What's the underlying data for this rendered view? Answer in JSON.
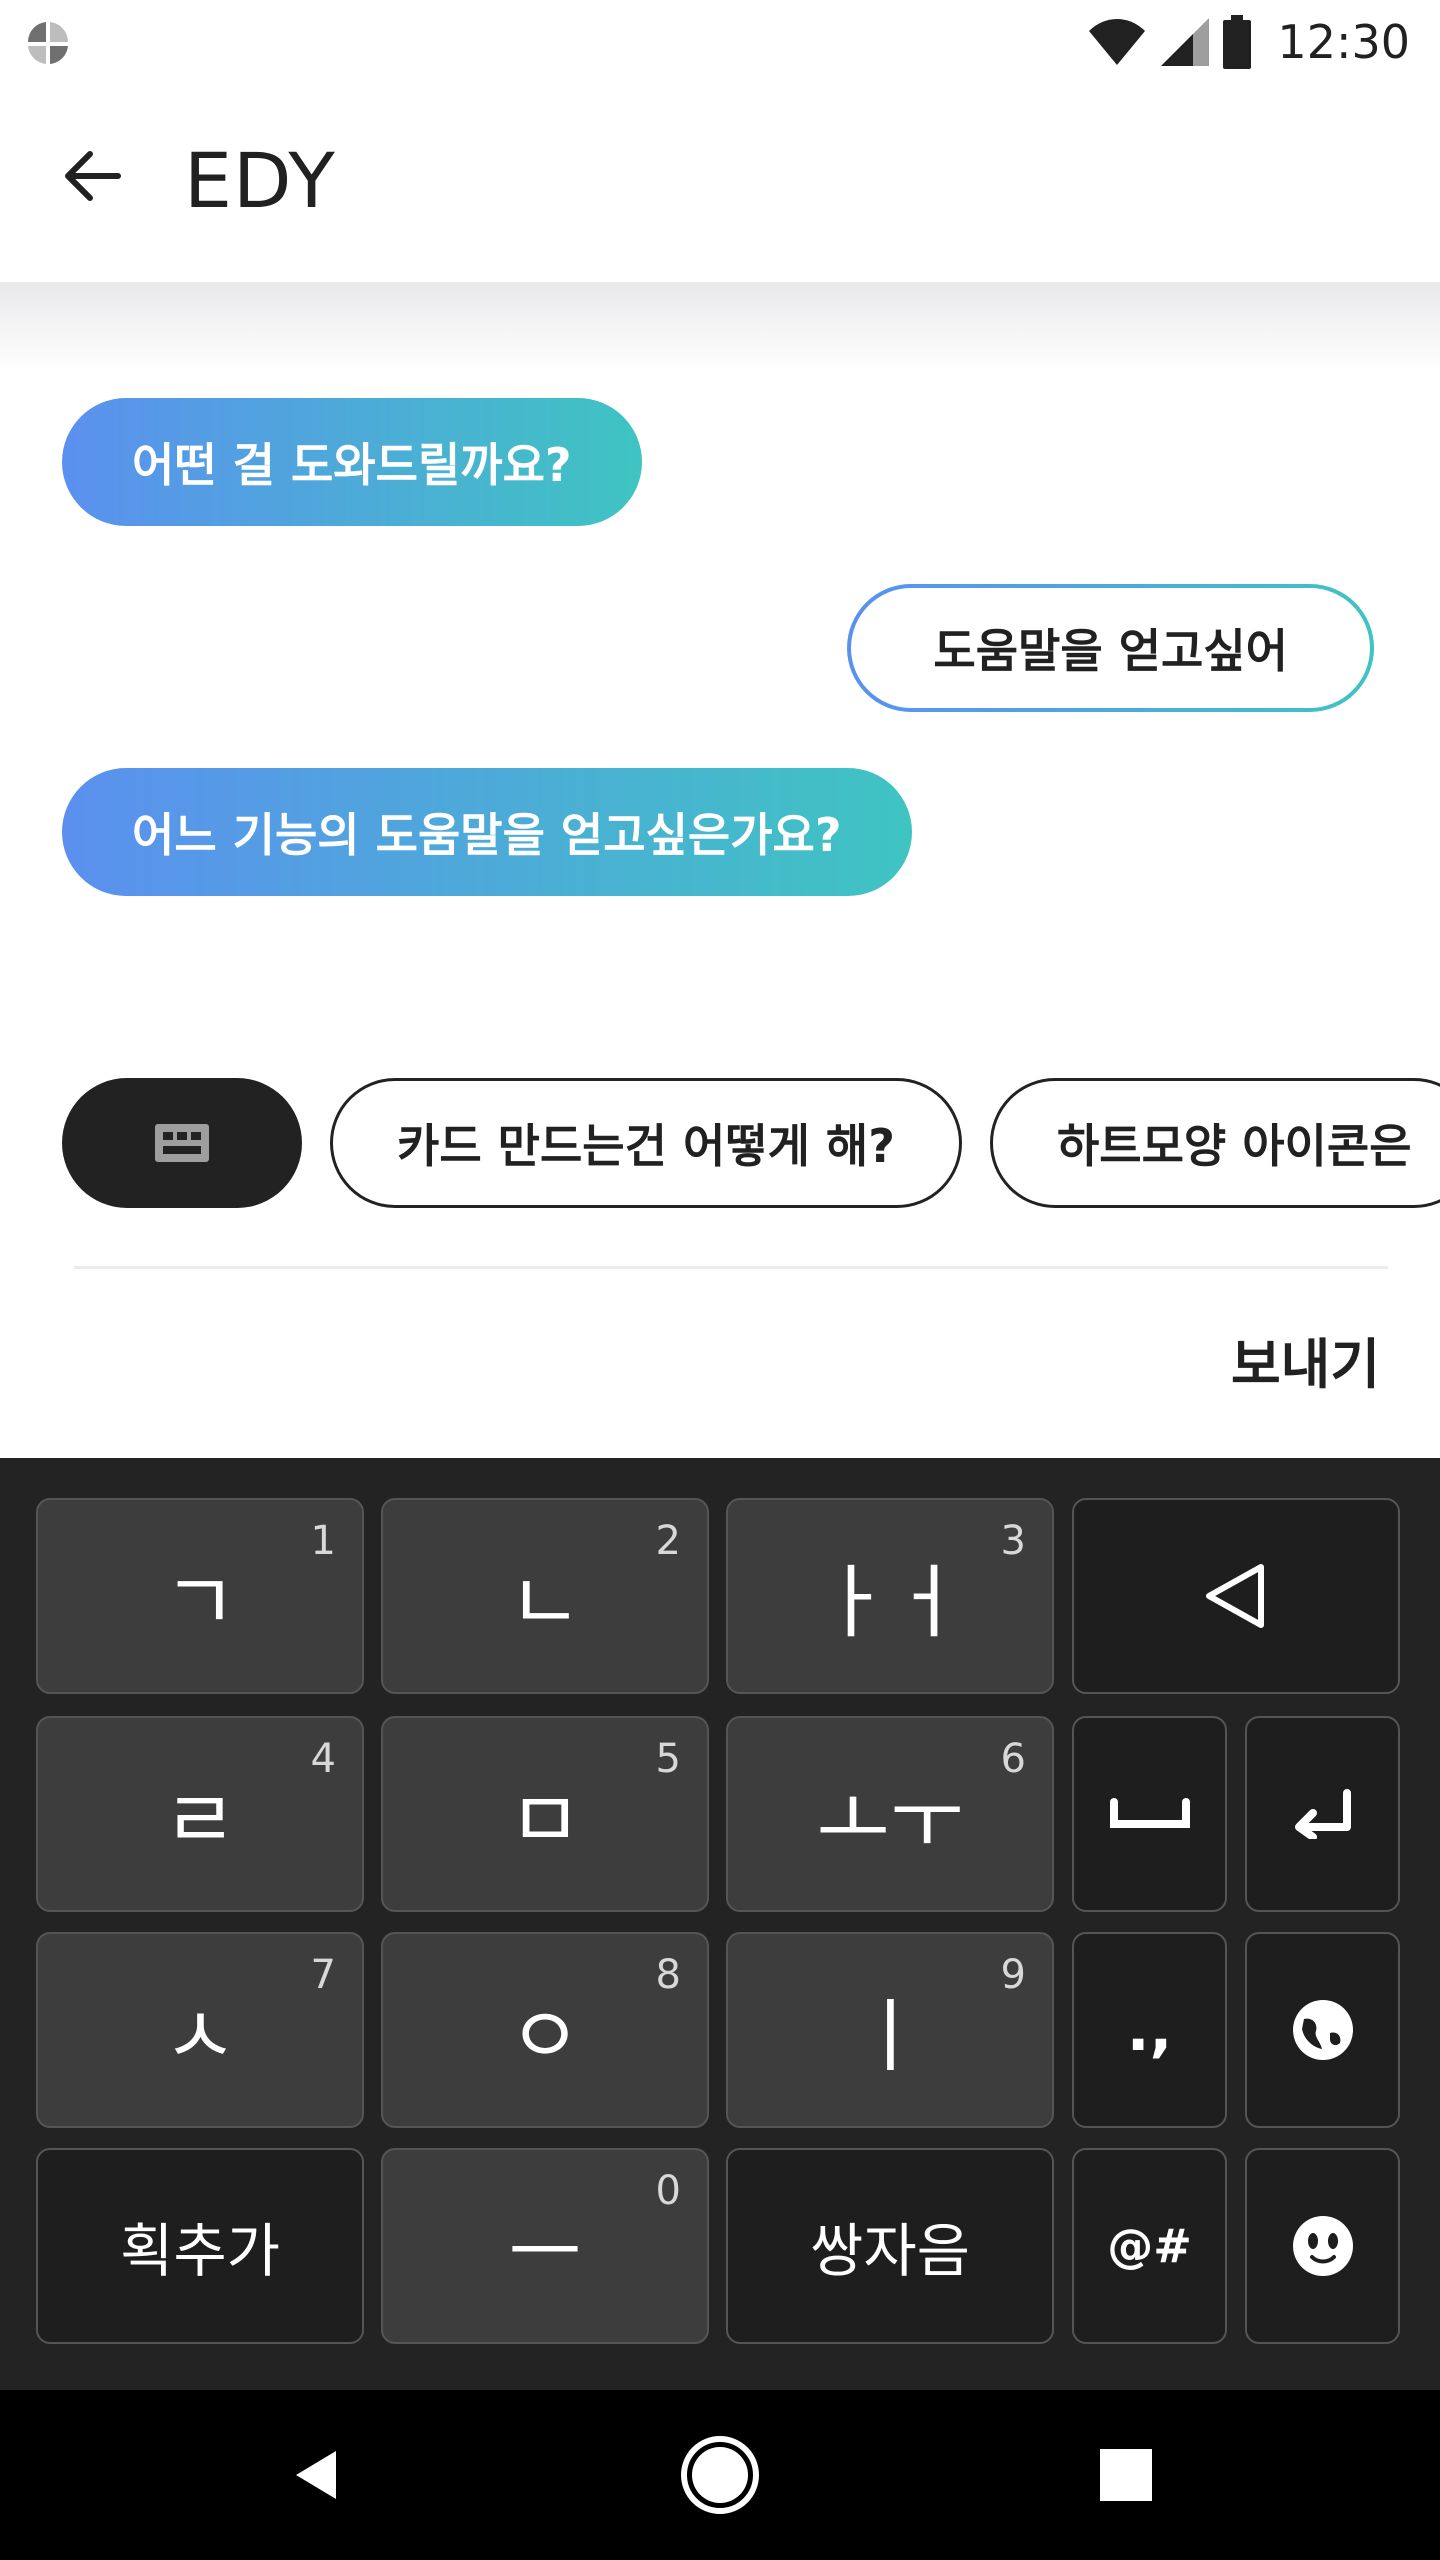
{
  "status": {
    "time": "12:30"
  },
  "app_bar": {
    "title": "EDY"
  },
  "chat": {
    "messages": [
      {
        "sender": "bot",
        "text": "어떤 걸 도와드릴까요?"
      },
      {
        "sender": "user",
        "text": "도움말을 얻고싶어"
      },
      {
        "sender": "bot",
        "text": "어느 기능의 도움말을 얻고싶은가요?"
      }
    ]
  },
  "suggestions": [
    "카드 만드는건 어떻게 해?",
    "하트모양 아이콘은"
  ],
  "input": {
    "send_label": "보내기"
  },
  "keyboard": {
    "rows": [
      [
        {
          "glyph": "ㄱ",
          "num": "1"
        },
        {
          "glyph": "ㄴ",
          "num": "2"
        },
        {
          "glyph": "ㅏㅓ",
          "num": "3"
        }
      ],
      [
        {
          "glyph": "ㄹ",
          "num": "4"
        },
        {
          "glyph": "ㅁ",
          "num": "5"
        },
        {
          "glyph": "ㅗㅜ",
          "num": "6"
        }
      ],
      [
        {
          "glyph": "ㅅ",
          "num": "7"
        },
        {
          "glyph": "ㅇ",
          "num": "8"
        },
        {
          "glyph": "ㅣ",
          "num": "9"
        }
      ]
    ],
    "stroke_key": "획추가",
    "dash_key": {
      "glyph": "ㅡ",
      "num": "0"
    },
    "double_key": "쌍자음",
    "punct_key": ".,",
    "symbol_key": "@#"
  },
  "colors": {
    "bubble_gradient_start": "#5b90ef",
    "bubble_gradient_end": "#3fc4c2",
    "keyboard_bg": "#232323",
    "key_light": "#3d3d3d",
    "key_dark": "#1e1e1e"
  }
}
